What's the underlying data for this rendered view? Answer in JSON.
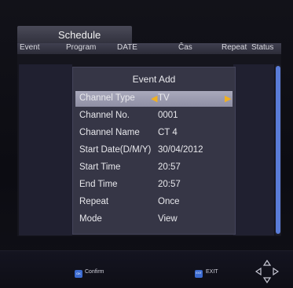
{
  "tab": {
    "title": "Schedule"
  },
  "columns": [
    "Event",
    "Program",
    "DATE",
    "Čas",
    "Repeat",
    "Status"
  ],
  "dialog": {
    "title": "Event Add",
    "fields": [
      {
        "label": "Channel Type",
        "value": "TV",
        "selected": true
      },
      {
        "label": "Channel No.",
        "value": "0001"
      },
      {
        "label": "Channel Name",
        "value": "CT 4"
      },
      {
        "label": "Start Date(D/M/Y)",
        "value": "30/04/2012"
      },
      {
        "label": "Start Time",
        "value": "20:57"
      },
      {
        "label": "End Time",
        "value": "20:57"
      },
      {
        "label": "Repeat",
        "value": "Once"
      },
      {
        "label": "Mode",
        "value": "View"
      }
    ]
  },
  "footer": {
    "confirm": {
      "key": "OK",
      "label": "Confirm"
    },
    "exit": {
      "key": "EXIT",
      "label": "EXIT"
    }
  },
  "colors": {
    "selection": "#9d9db0",
    "arrow": "#f0b020",
    "scroll": "#5a7cd8",
    "key": "#3c6bd0"
  }
}
